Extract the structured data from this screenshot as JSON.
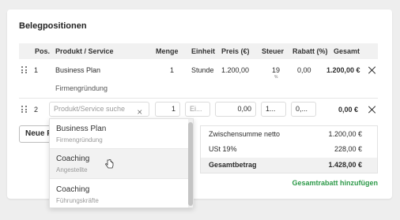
{
  "section": {
    "title": "Belegpositionen"
  },
  "table": {
    "headers": {
      "pos": "Pos.",
      "product": "Produkt / Service",
      "qty": "Menge",
      "unit": "Einheit",
      "price": "Preis (€)",
      "tax": "Steuer",
      "discount": "Rabatt (%)",
      "total": "Gesamt"
    },
    "row1": {
      "pos": "1",
      "product": "Business Plan",
      "description": "Firmengründung",
      "qty": "1",
      "unit": "Stunde",
      "price": "1.200,00",
      "tax": "19",
      "tax_sub": "%",
      "discount": "0,00",
      "total": "1.200,00 €"
    },
    "row2": {
      "pos": "2",
      "product_placeholder": "Produkt/Service suche",
      "qty": "1",
      "unit_placeholder": "Ei...",
      "price": "0,00",
      "tax": "1...",
      "discount": "0,...",
      "total": "0,00 €"
    }
  },
  "new_button": {
    "label": "Neue P"
  },
  "dropdown": {
    "options": [
      {
        "title": "Business Plan",
        "subtitle": "Firmengründung"
      },
      {
        "title": "Coaching",
        "subtitle": "Angestellte"
      },
      {
        "title": "Coaching",
        "subtitle": "Führungskräfte"
      }
    ]
  },
  "totals": {
    "subtotal_label": "Zwischensumme netto",
    "subtotal_value": "1.200,00 €",
    "tax_label": "USt 19%",
    "tax_value": "228,00 €",
    "grand_label": "Gesamtbetrag",
    "grand_value": "1.428,00 €"
  },
  "discount_link": "Gesamtrabatt hinzufügen",
  "colors": {
    "accent_green": "#2e9a4a",
    "header_bg": "#f1f1f1"
  }
}
